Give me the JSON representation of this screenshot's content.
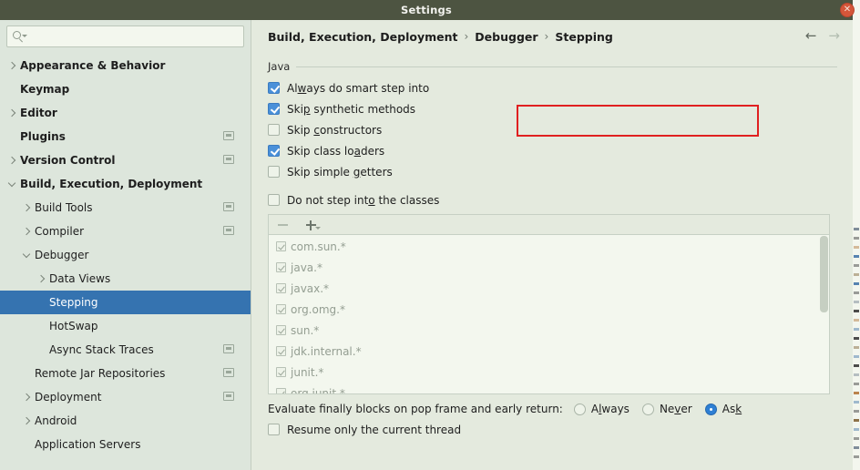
{
  "window": {
    "title": "Settings",
    "close_label": "✕"
  },
  "search": {
    "value": "",
    "placeholder": ""
  },
  "sidebar": {
    "items": [
      {
        "label": "Appearance & Behavior",
        "indent": 0,
        "chevron": "right",
        "bold": true,
        "scope": false,
        "selected": false
      },
      {
        "label": "Keymap",
        "indent": 0,
        "chevron": "none",
        "bold": true,
        "scope": false,
        "selected": false
      },
      {
        "label": "Editor",
        "indent": 0,
        "chevron": "right",
        "bold": true,
        "scope": false,
        "selected": false
      },
      {
        "label": "Plugins",
        "indent": 0,
        "chevron": "none",
        "bold": true,
        "scope": true,
        "selected": false
      },
      {
        "label": "Version Control",
        "indent": 0,
        "chevron": "right",
        "bold": true,
        "scope": true,
        "selected": false
      },
      {
        "label": "Build, Execution, Deployment",
        "indent": 0,
        "chevron": "down",
        "bold": true,
        "scope": false,
        "selected": false
      },
      {
        "label": "Build Tools",
        "indent": 1,
        "chevron": "right",
        "bold": false,
        "scope": true,
        "selected": false
      },
      {
        "label": "Compiler",
        "indent": 1,
        "chevron": "right",
        "bold": false,
        "scope": true,
        "selected": false
      },
      {
        "label": "Debugger",
        "indent": 1,
        "chevron": "down",
        "bold": false,
        "scope": false,
        "selected": false
      },
      {
        "label": "Data Views",
        "indent": 2,
        "chevron": "right",
        "bold": false,
        "scope": false,
        "selected": false
      },
      {
        "label": "Stepping",
        "indent": 2,
        "chevron": "none",
        "bold": false,
        "scope": false,
        "selected": true
      },
      {
        "label": "HotSwap",
        "indent": 2,
        "chevron": "none",
        "bold": false,
        "scope": false,
        "selected": false
      },
      {
        "label": "Async Stack Traces",
        "indent": 2,
        "chevron": "none",
        "bold": false,
        "scope": true,
        "selected": false
      },
      {
        "label": "Remote Jar Repositories",
        "indent": 1,
        "chevron": "none",
        "bold": false,
        "scope": true,
        "selected": false
      },
      {
        "label": "Deployment",
        "indent": 1,
        "chevron": "right",
        "bold": false,
        "scope": true,
        "selected": false
      },
      {
        "label": "Android",
        "indent": 1,
        "chevron": "right",
        "bold": false,
        "scope": false,
        "selected": false
      },
      {
        "label": "Application Servers",
        "indent": 1,
        "chevron": "none",
        "bold": false,
        "scope": false,
        "selected": false
      }
    ]
  },
  "breadcrumb": {
    "parts": [
      "Build, Execution, Deployment",
      "Debugger",
      "Stepping"
    ],
    "separator": "›",
    "back_arrow": "←",
    "forward_arrow": "→"
  },
  "main": {
    "group_label": "Java",
    "options": [
      {
        "label": "Always do smart step into",
        "mnemonic_index": 2,
        "checked": true,
        "highlighted": true
      },
      {
        "label": "Skip synthetic methods",
        "mnemonic_index": 3,
        "checked": true,
        "highlighted": false
      },
      {
        "label": "Skip constructors",
        "mnemonic_index": 5,
        "checked": false,
        "highlighted": false
      },
      {
        "label": "Skip class loaders",
        "mnemonic_index": 13,
        "checked": true,
        "highlighted": false
      },
      {
        "label": "Skip simple getters",
        "mnemonic_index": 12,
        "checked": false,
        "highlighted": false
      }
    ],
    "do_not_step": {
      "label": "Do not step into the classes",
      "mnemonic_index": 15,
      "checked": false
    },
    "list_toolbar": {
      "remove_label": "−",
      "add_label": "+"
    },
    "class_list": [
      {
        "pattern": "com.sun.*",
        "checked": true
      },
      {
        "pattern": "java.*",
        "checked": true
      },
      {
        "pattern": "javax.*",
        "checked": true
      },
      {
        "pattern": "org.omg.*",
        "checked": true
      },
      {
        "pattern": "sun.*",
        "checked": true
      },
      {
        "pattern": "jdk.internal.*",
        "checked": true
      },
      {
        "pattern": "junit.*",
        "checked": true
      },
      {
        "pattern": "org.junit.*",
        "checked": true
      }
    ],
    "evaluate_label": "Evaluate finally blocks on pop frame and early return:",
    "evaluate_options": [
      {
        "label": "Always",
        "mnemonic_index": 1,
        "selected": false
      },
      {
        "label": "Never",
        "mnemonic_index": 2,
        "selected": false
      },
      {
        "label": "Ask",
        "mnemonic_index": 2,
        "selected": true
      }
    ],
    "resume_option": {
      "label": "Resume only the current thread",
      "checked": false
    }
  },
  "colors": {
    "titlebar": "#4d5441",
    "selection": "#3573b0",
    "checkbox_on": "#4a90d9",
    "radio_on": "#2e7fd4",
    "highlight": "#e02020",
    "panel_bg": "#e4eade",
    "sidebar_bg": "#dde6dc"
  }
}
